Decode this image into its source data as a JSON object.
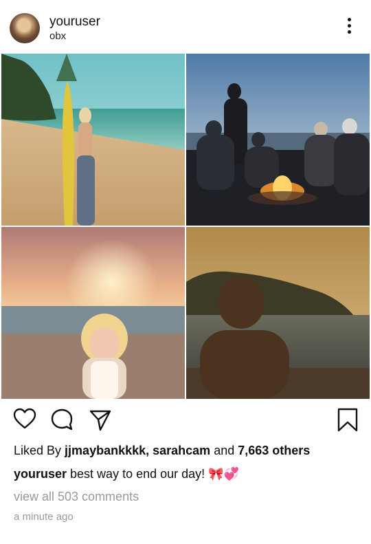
{
  "post": {
    "username": "youruser",
    "location": "obx",
    "liked_by_prefix": "Liked By ",
    "liked_by_users": "jjmaybankkkk, sarahcam",
    "liked_by_connector": " and ",
    "liked_by_count": "7,663 others",
    "caption_user": "youruser",
    "caption_text": " best way to end our day! 🎀💞",
    "view_comments": "view all 503 comments",
    "timestamp": "a minute ago"
  },
  "icons": {
    "more": "more-options-icon",
    "like": "heart-icon",
    "comment": "comment-icon",
    "share": "share-icon",
    "save": "bookmark-icon"
  },
  "photos": [
    {
      "id": "photo-surfer-beach"
    },
    {
      "id": "photo-bonfire-sunset"
    },
    {
      "id": "photo-girl-beach-sunset"
    },
    {
      "id": "photo-silhouette-bay"
    }
  ]
}
